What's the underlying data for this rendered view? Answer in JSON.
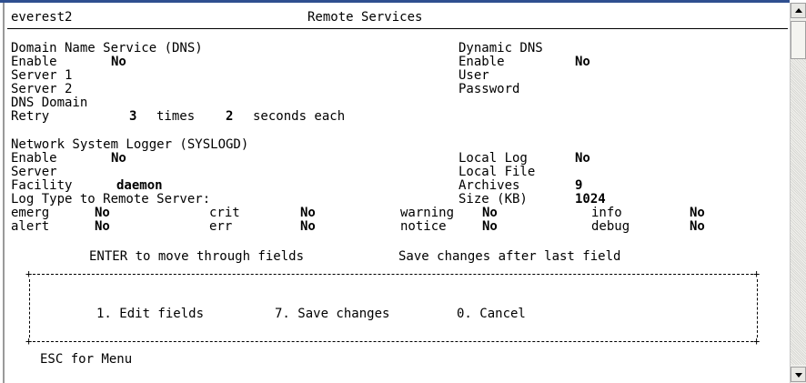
{
  "header": {
    "host": "everest2",
    "title": "Remote Services"
  },
  "dns": {
    "section_title": "Domain Name Service (DNS)",
    "enable_label": "Enable",
    "enable_value": "No",
    "server1_label": "Server 1",
    "server2_label": "Server 2",
    "domain_label": "DNS Domain",
    "retry_label": "Retry",
    "retry_count": "3",
    "times_label": "times",
    "retry_seconds": "2",
    "seconds_label": "seconds each"
  },
  "ddns": {
    "section_title": "Dynamic DNS",
    "enable_label": "Enable",
    "enable_value": "No",
    "user_label": "User",
    "password_label": "Password"
  },
  "syslog": {
    "section_title": "Network System Logger (SYSLOGD)",
    "enable_label": "Enable",
    "enable_value": "No",
    "server_label": "Server",
    "facility_label": "Facility",
    "facility_value": "daemon",
    "logtype_label": "Log Type to Remote Server:",
    "local_log_label": "Local Log",
    "local_log_value": "No",
    "local_file_label": "Local File",
    "archives_label": "Archives",
    "archives_value": "9",
    "size_label": "Size (KB)",
    "size_value": "1024",
    "levels": [
      {
        "label": "emerg",
        "value": "No"
      },
      {
        "label": "crit",
        "value": "No"
      },
      {
        "label": "warning",
        "value": "No"
      },
      {
        "label": "info",
        "value": "No"
      },
      {
        "label": "alert",
        "value": "No"
      },
      {
        "label": "err",
        "value": "No"
      },
      {
        "label": "notice",
        "value": "No"
      },
      {
        "label": "debug",
        "value": "No"
      }
    ]
  },
  "hint": {
    "left": "ENTER to move through fields",
    "right": "Save changes after last field"
  },
  "menu": {
    "edit": "1. Edit fields",
    "save": "7. Save changes",
    "cancel": "0. Cancel"
  },
  "footer": {
    "esc": "ESC for Menu"
  }
}
